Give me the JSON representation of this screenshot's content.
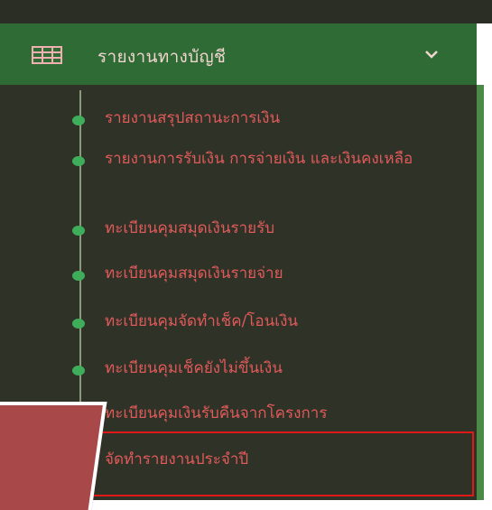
{
  "menu": {
    "title": "รายงานทางบัญชี",
    "items": [
      {
        "label": "รายงานสรุปสถานะการเงิน"
      },
      {
        "label": "รายงานการรับเงิน การจ่ายเงิน และเงินคงเหลือ"
      },
      {
        "label": "ทะเบียนคุมสมุดเงินรายรับ"
      },
      {
        "label": "ทะเบียนคุมสมุดเงินรายจ่าย"
      },
      {
        "label": "ทะเบียนคุมจัดทำเช็ค/โอนเงิน"
      },
      {
        "label": "ทะเบียนคุมเช็คยังไม่ขึ้นเงิน"
      },
      {
        "label": "ทะเบียนคุมเงินรับคืนจากโครงการ"
      },
      {
        "label": "จัดทำรายงานประจำปี"
      }
    ]
  },
  "colors": {
    "header_bg": "#2f6b34",
    "panel_bg": "#2f3227",
    "item_text": "#e05a5a",
    "bullet": "#3fae5a",
    "highlight": "#e01818",
    "overlay": "#a94848"
  },
  "icons": {
    "menu_icon": "grid-table-icon",
    "toggle_icon": "chevron-down-icon",
    "bullet_icon": "dot-icon"
  }
}
